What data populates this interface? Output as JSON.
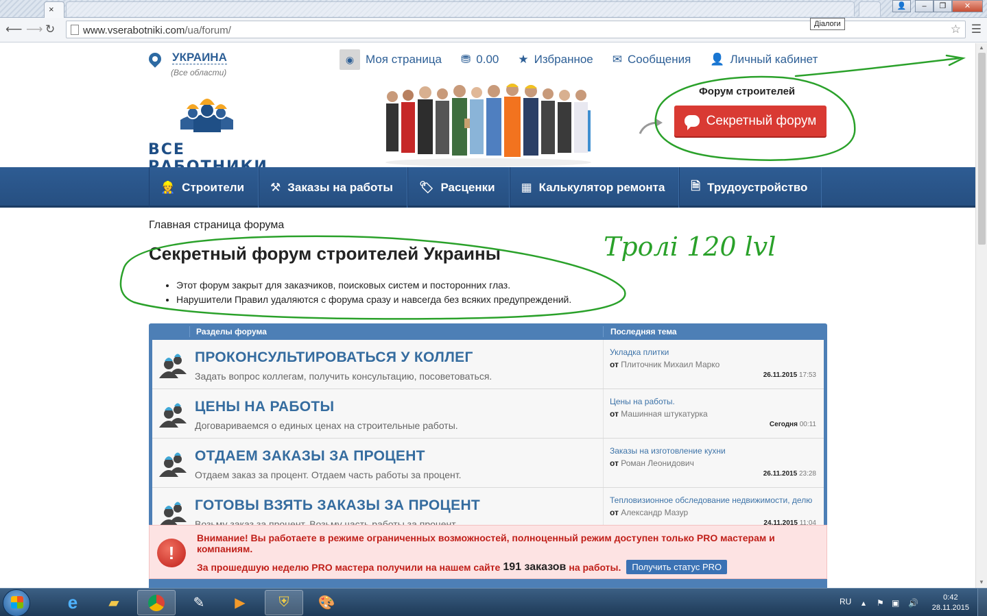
{
  "browser": {
    "url_host": "www.vserabotniki.com",
    "url_path": "/ua/forum/",
    "tooltip": "Діалоги",
    "tab_close": "×"
  },
  "header": {
    "location_name": "УКРАИНА",
    "location_sub": "(Все области)",
    "topmenu": {
      "my_page": "Моя страница",
      "balance": "0.00",
      "favorites": "Избранное",
      "messages": "Сообщения",
      "cabinet": "Личный кабинет"
    },
    "logo_text": "ВСЕ РАБОТНИКИ",
    "forum_label": "Форум строителей",
    "secret_forum_button": "Секретный форум"
  },
  "nav": {
    "items": [
      {
        "label": "Строители",
        "icon": "builder-icon"
      },
      {
        "label": "Заказы на работы",
        "icon": "hammer-icon"
      },
      {
        "label": "Расценки",
        "icon": "tag-icon"
      },
      {
        "label": "Калькулятор ремонта",
        "icon": "calculator-icon"
      },
      {
        "label": "Трудоустройство",
        "icon": "document-icon"
      }
    ]
  },
  "main": {
    "breadcrumb": "Главная страница форума",
    "title": "Секретный форум строителей Украины",
    "rules": [
      "Этот форум закрыт для заказчиков, поисковых систем и посторонних глаз.",
      "Нарушители Правил удаляются с форума сразу и навсегда без всяких предупреждений."
    ]
  },
  "forum": {
    "col_sections": "Разделы форума",
    "col_last": "Последняя тема",
    "author_prefix": "от",
    "rows": [
      {
        "title": "ПРОКОНСУЛЬТИРОВАТЬСЯ У КОЛЛЕГ",
        "desc": "Задать вопрос коллегам, получить консультацию, посоветоваться.",
        "last_topic": "Укладка плитки",
        "last_author": "Плиточник Михаил Марко",
        "date": "26.11.2015",
        "time": "17:53"
      },
      {
        "title": "ЦЕНЫ НА РАБОТЫ",
        "desc": "Договариваемся о единых ценах на строительные работы.",
        "last_topic": "Цены на работы.",
        "last_author": "Машинная штукатурка",
        "date": "Сегодня",
        "time": "00:11"
      },
      {
        "title": "ОТДАЕМ ЗАКАЗЫ ЗА ПРОЦЕНТ",
        "desc": "Отдаем заказ за процент. Отдаем часть работы за процент.",
        "last_topic": "Заказы на изготовление кухни",
        "last_author": "Роман Леонидович",
        "date": "26.11.2015",
        "time": "23:28"
      },
      {
        "title": "ГОТОВЫ ВЗЯТЬ ЗАКАЗЫ ЗА ПРОЦЕНТ",
        "desc": "Возьму заказ за процент. Возьму часть работы за процент.",
        "last_topic": "Тепловизионное обследование недвижимости, делю",
        "last_author": "Александр Мазур",
        "date": "24.11.2015",
        "time": "11:04"
      }
    ]
  },
  "warning": {
    "line1": "Внимание! Вы работаете в режиме ограниченных возможностей, полноценный режим доступен только PRO мастерам и компаниям.",
    "line2_pre": "За прошедшую неделю PRO мастера получили на нашем сайте",
    "line2_num": "191 заказов",
    "line2_post": "на работы.",
    "button": "Получить статус PRO"
  },
  "annotation": {
    "text": "Тролі 120 lvl",
    "color": "#2aa12a"
  },
  "taskbar": {
    "lang": "RU",
    "time": "0:42",
    "date": "28.11.2015"
  },
  "colors": {
    "nav_blue": "#2e5c93",
    "link_blue": "#356c9f",
    "alert_red": "#d93a33"
  }
}
